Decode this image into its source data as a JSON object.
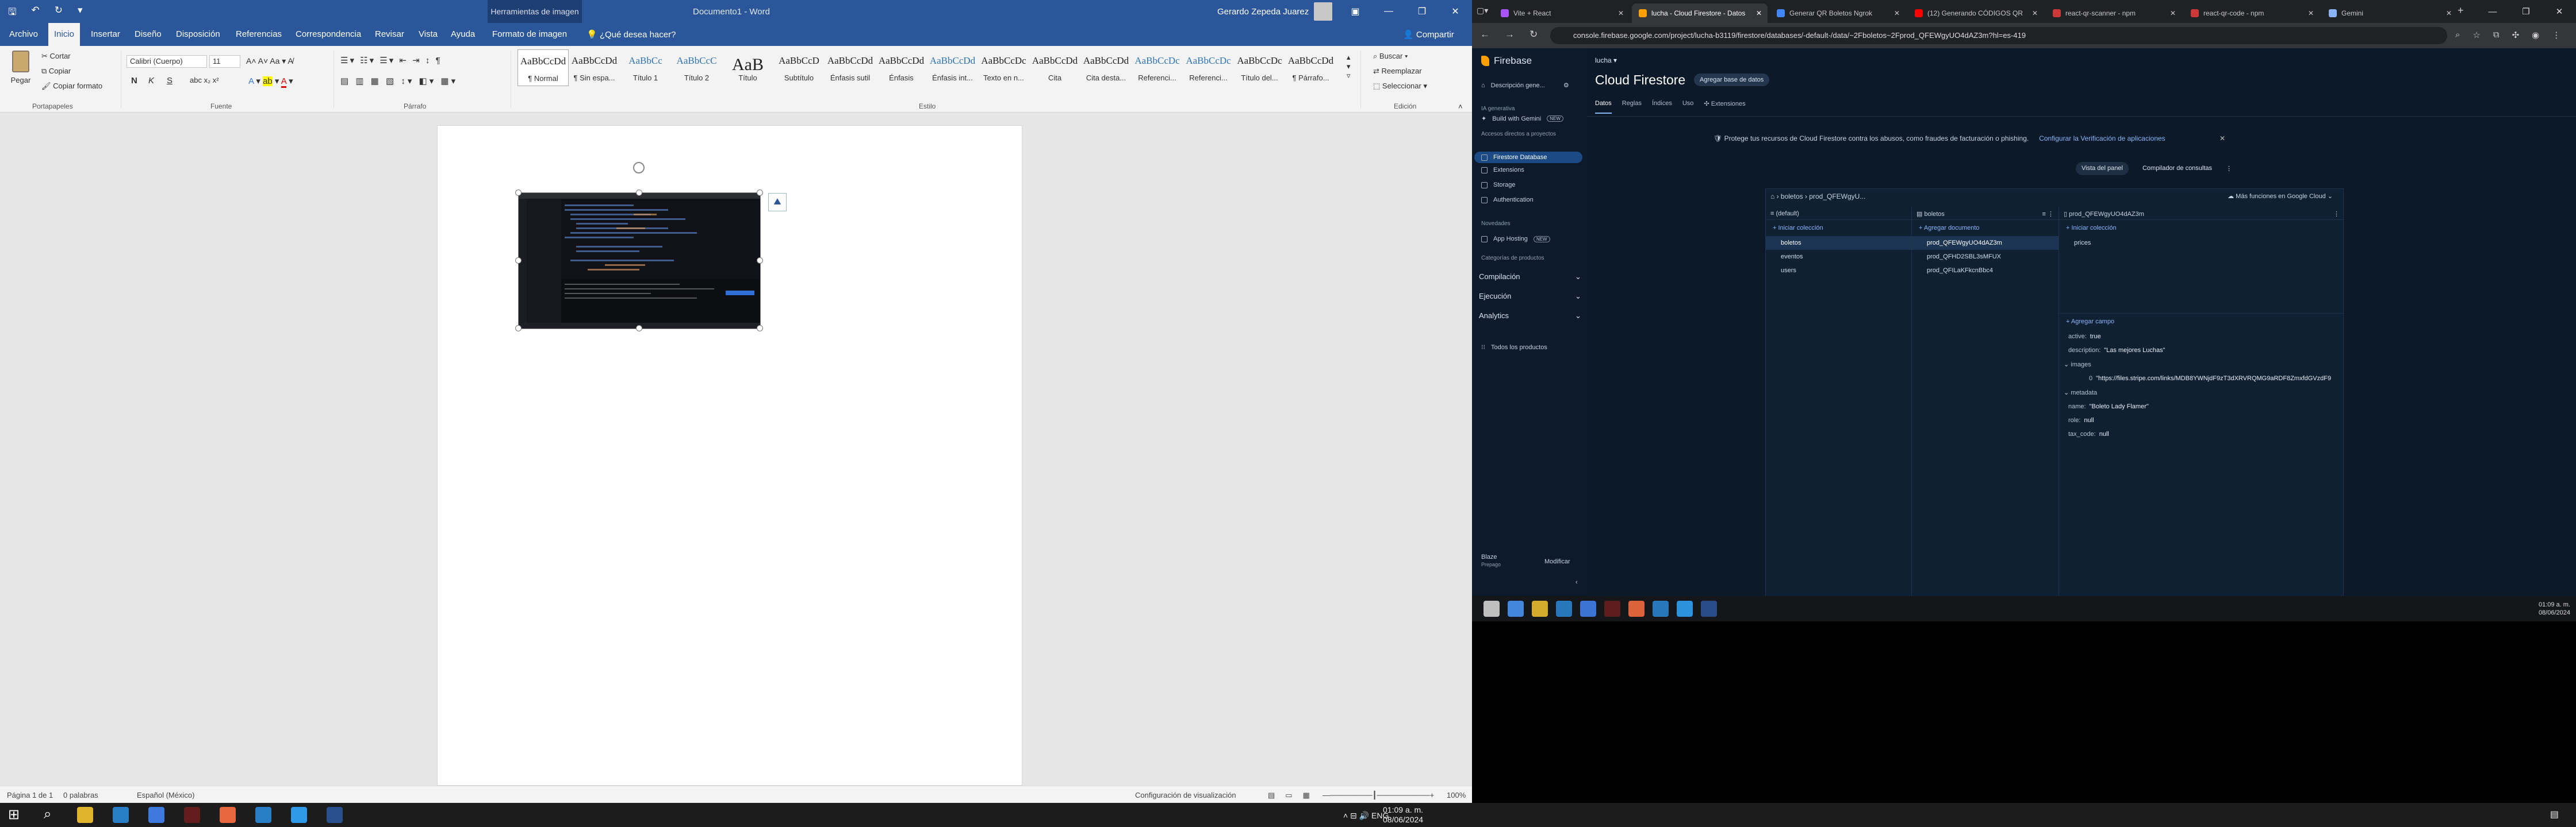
{
  "word": {
    "title": {
      "context_tab": "Herramientas de imagen",
      "doc": "Documento1 - Word",
      "user": "Gerardo Zepeda Juarez"
    },
    "tabs": [
      "Archivo",
      "Inicio",
      "Insertar",
      "Diseño",
      "Disposición",
      "Referencias",
      "Correspondencia",
      "Revisar",
      "Vista",
      "Ayuda",
      "Formato de imagen"
    ],
    "tell_me": "¿Qué desea hacer?",
    "share": "Compartir",
    "clipboard": {
      "paste": "Pegar",
      "cut": "Cortar",
      "copy": "Copiar",
      "format": "Copiar formato",
      "label": "Portapapeles"
    },
    "font": {
      "name": "Calibri (Cuerpo)",
      "size": "11",
      "label": "Fuente"
    },
    "paragraph_label": "Párrafo",
    "styles_label": "Estilo",
    "styles": [
      {
        "preview": "AaBbCcDd",
        "name": "¶ Normal"
      },
      {
        "preview": "AaBbCcDd",
        "name": "¶ Sin espa..."
      },
      {
        "preview": "AaBbCc",
        "name": "Título 1"
      },
      {
        "preview": "AaBbCcC",
        "name": "Título 2"
      },
      {
        "preview": "AaB",
        "name": "Título"
      },
      {
        "preview": "AaBbCcD",
        "name": "Subtítulo"
      },
      {
        "preview": "AaBbCcDd",
        "name": "Énfasis sutil"
      },
      {
        "preview": "AaBbCcDd",
        "name": "Énfasis"
      },
      {
        "preview": "AaBbCcDd",
        "name": "Énfasis int..."
      },
      {
        "preview": "AaBbCcDc",
        "name": "Texto en n..."
      },
      {
        "preview": "AaBbCcDd",
        "name": "Cita"
      },
      {
        "preview": "AaBbCcDd",
        "name": "Cita desta..."
      },
      {
        "preview": "AaBbCcDc",
        "name": "Referenci..."
      },
      {
        "preview": "AaBbCcDc",
        "name": "Referenci..."
      },
      {
        "preview": "AaBbCcDc",
        "name": "Título del..."
      },
      {
        "preview": "AaBbCcDd",
        "name": "¶ Párrafo..."
      }
    ],
    "editing": {
      "find": "Buscar",
      "replace": "Reemplazar",
      "select": "Seleccionar",
      "label": "Edición"
    },
    "status": {
      "page": "Página 1 de 1",
      "words": "0 palabras",
      "lang": "Español (México)",
      "view": "Configuración de visualización",
      "zoom": "100%"
    }
  },
  "browser": {
    "tabs": [
      {
        "label": "Vite + React",
        "color": "#a855f7"
      },
      {
        "label": "lucha - Cloud Firestore - Datos",
        "color": "#ffa000"
      },
      {
        "label": "Generar QR Boletos Ngrok",
        "color": "#4285f4"
      },
      {
        "label": "(12) Generando CÓDIGOS QR",
        "color": "#ff0000"
      },
      {
        "label": "react-qr-scanner - npm",
        "color": "#cb3837"
      },
      {
        "label": "react-qr-code - npm",
        "color": "#cb3837"
      },
      {
        "label": "Gemini",
        "color": "#8ab4f8"
      }
    ],
    "url": "console.firebase.google.com/project/lucha-b3119/firestore/databases/-default-/data/~2Fboletos~2Fprod_QFEWgyUO4dAZ3m?hl=es-419"
  },
  "firebase": {
    "brand": "Firebase",
    "overview": "Descripción gene...",
    "gen_ai": "IA generativa",
    "build_gemini": "Build with Gemini",
    "new_badge": "NEW",
    "shortcuts": "Accesos directos a proyectos",
    "items": [
      "Firestore Database",
      "Extensions",
      "Storage",
      "Authentication"
    ],
    "novelties": "Novedades",
    "app_hosting": "App Hosting",
    "categories": "Categorías de productos",
    "expanders": [
      "Compilación",
      "Ejecución",
      "Analytics"
    ],
    "all_products": "Todos los productos",
    "plan": "Blaze",
    "plan_sub": "Prepago",
    "modify": "Modificar"
  },
  "firestore": {
    "project": "lucha",
    "title": "Cloud Firestore",
    "db_button": "Agregar base de datos",
    "tabs": [
      "Datos",
      "Reglas",
      "Índices",
      "Uso",
      "Extensiones"
    ],
    "banner": "Protege tus recursos de Cloud Firestore contra los abusos, como fraudes de facturación o phishing.",
    "banner_link": "Configurar la Verificación de aplicaciones",
    "view_panel": "Vista del panel",
    "query_builder": "Compilador de consultas",
    "crumb": [
      "boletos",
      "prod_QFEWgyU..."
    ],
    "gcloud": "Más funciones en Google Cloud",
    "col1": {
      "header": "(default)",
      "add": "Iniciar colección",
      "items": [
        "boletos",
        "eventos",
        "users"
      ]
    },
    "col2": {
      "header": "boletos",
      "add": "Agregar documento",
      "items": [
        "prod_QFEWgyUO4dAZ3m",
        "prod_QFHD2SBL3sMFUX",
        "prod_QFILaKFkcnBbc4"
      ]
    },
    "col3": {
      "header": "prod_QFEWgyUO4dAZ3m",
      "add": "Iniciar colección",
      "sub": "prices",
      "add_field": "Agregar campo",
      "fields": [
        {
          "k": "active:",
          "v": "true"
        },
        {
          "k": "description:",
          "v": "\"Las mejores Luchas\""
        },
        {
          "k": "images",
          "v": ""
        },
        {
          "k": "0",
          "v": "\"https://files.stripe.com/links/MDB8YWNjdF9zT3dXRVRQMG9aRDF8ZmxfdGVzdF9"
        },
        {
          "k": "metadata",
          "v": ""
        },
        {
          "k": "name:",
          "v": "\"Boleto Lady Flamer\""
        },
        {
          "k": "role:",
          "v": "null"
        },
        {
          "k": "tax_code:",
          "v": "null"
        }
      ]
    }
  },
  "browser_clock": {
    "time": "01:09 a. m.",
    "date": "08/06/2024"
  },
  "taskbar": {
    "lang": "ENG",
    "time": "01:09 a. m.",
    "date": "08/06/2024"
  }
}
